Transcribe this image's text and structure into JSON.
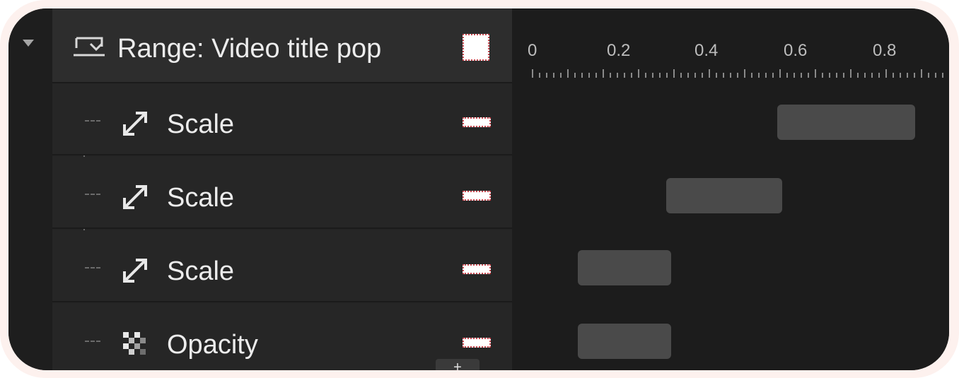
{
  "track": {
    "header": {
      "label": "Range: Video title pop",
      "icon": "range-icon"
    },
    "rows": [
      {
        "label": "Scale",
        "icon": "scale-arrow-icon"
      },
      {
        "label": "Scale",
        "icon": "scale-arrow-icon"
      },
      {
        "label": "Scale",
        "icon": "scale-arrow-icon"
      },
      {
        "label": "Opacity",
        "icon": "opacity-checker-icon"
      }
    ],
    "add_label": "+"
  },
  "timeline": {
    "ticks": [
      "0",
      "0.2",
      "0.4",
      "0.6",
      "0.8"
    ],
    "clips": [
      {
        "start": 0.55,
        "end": 0.86
      },
      {
        "start": 0.3,
        "end": 0.56
      },
      {
        "start": 0.1,
        "end": 0.31
      },
      {
        "start": 0.1,
        "end": 0.31
      }
    ]
  },
  "colors": {
    "swatch": "#ffffff",
    "swatch_border": "#c8474f",
    "clip": "#4a4a4a"
  }
}
